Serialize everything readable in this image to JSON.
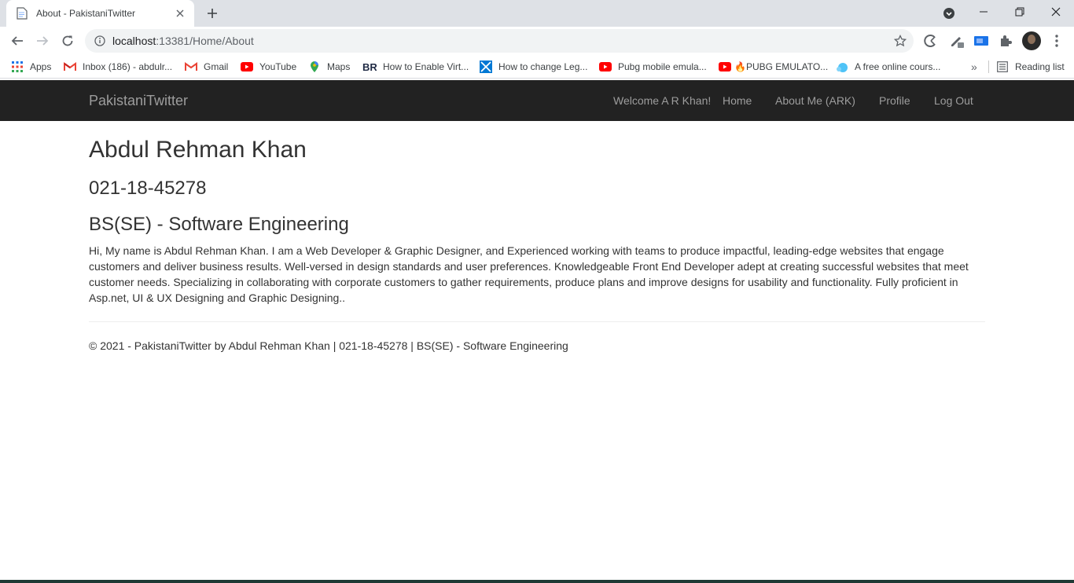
{
  "browser": {
    "tab_title": "About - PakistaniTwitter",
    "url_host": "localhost",
    "url_rest": ":13381/Home/About",
    "bookmarks": [
      {
        "label": "Apps",
        "icon": "apps-grid-icon"
      },
      {
        "label": "Inbox (186) - abdulr...",
        "icon": "gmail-icon"
      },
      {
        "label": "Gmail",
        "icon": "gmail-icon"
      },
      {
        "label": "YouTube",
        "icon": "youtube-icon"
      },
      {
        "label": "Maps",
        "icon": "maps-pin-icon"
      },
      {
        "label": "How to Enable Virt...",
        "icon": "br-logo-icon"
      },
      {
        "label": "How to change Leg...",
        "icon": "x-logo-icon"
      },
      {
        "label": "Pubg mobile emula...",
        "icon": "youtube-icon"
      },
      {
        "label": "🔥PUBG EMULATO...",
        "icon": "youtube-icon"
      },
      {
        "label": "A free online cours...",
        "icon": "course-icon"
      }
    ],
    "reading_list": "Reading list",
    "overflow": "»"
  },
  "navbar": {
    "brand": "PakistaniTwitter",
    "welcome": "Welcome A R Khan!",
    "links": [
      "Home",
      "About Me (ARK)",
      "Profile",
      "Log Out"
    ]
  },
  "about": {
    "name": "Abdul Rehman Khan",
    "phone": "021-18-45278",
    "degree": "BS(SE) - Software Engineering",
    "bio": "Hi, My name is Abdul Rehman Khan. I am a Web Developer & Graphic Designer, and Experienced working with teams to produce impactful, leading-edge websites that engage customers and deliver business results. Well-versed in design standards and user preferences. Knowledgeable Front End Developer adept at creating successful websites that meet customer needs. Specializing in collaborating with corporate customers to gather requirements, produce plans and improve designs for usability and functionality. Fully proficient in Asp.net, UI & UX Designing and Graphic Designing.."
  },
  "footer": {
    "text": "© 2021 - PakistaniTwitter by Abdul Rehman Khan | 021-18-45278 | BS(SE) - Software Engineering"
  },
  "colors": {
    "navbar_bg": "#222222",
    "nav_text": "#9d9d9d",
    "chrome_bg": "#dee1e6"
  }
}
